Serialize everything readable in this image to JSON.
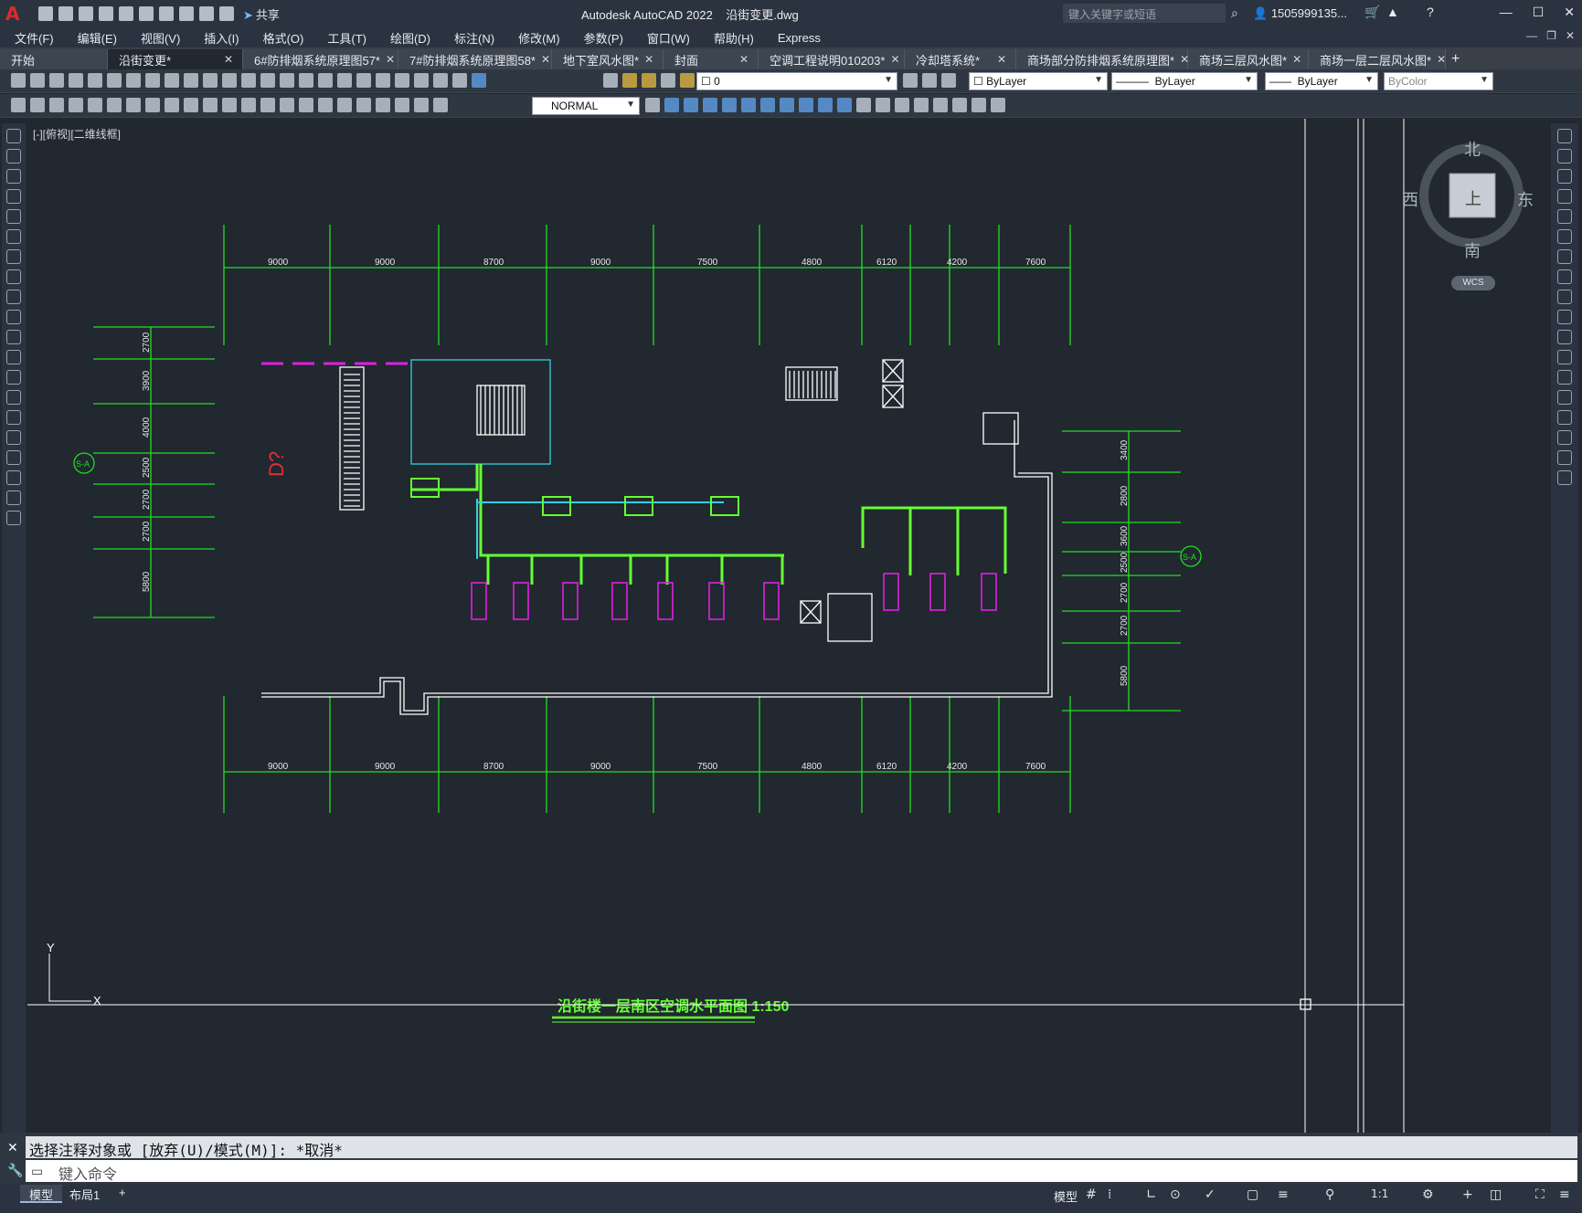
{
  "window": {
    "title": "Autodesk AutoCAD 2022",
    "filename": "沿街变更.dwg",
    "share": "共享",
    "search_placeholder": "键入关键字或短语",
    "user": "1505999135...",
    "logo": "A"
  },
  "menu": [
    "文件(F)",
    "编辑(E)",
    "视图(V)",
    "插入(I)",
    "格式(O)",
    "工具(T)",
    "绘图(D)",
    "标注(N)",
    "修改(M)",
    "参数(P)",
    "窗口(W)",
    "帮助(H)",
    "Express"
  ],
  "tabs": [
    {
      "label": "开始",
      "active": false,
      "closable": false
    },
    {
      "label": "沿街变更*",
      "active": true,
      "closable": true
    },
    {
      "label": "6#防排烟系统原理图57*",
      "active": false,
      "closable": true
    },
    {
      "label": "7#防排烟系统原理图58*",
      "active": false,
      "closable": true
    },
    {
      "label": "地下室风水图*",
      "active": false,
      "closable": true
    },
    {
      "label": "封面",
      "active": false,
      "closable": true
    },
    {
      "label": "空调工程说明010203*",
      "active": false,
      "closable": true
    },
    {
      "label": "冷却塔系统*",
      "active": false,
      "closable": true
    },
    {
      "label": "商场部分防排烟系统原理图*",
      "active": false,
      "closable": true
    },
    {
      "label": "商场三层风水图*",
      "active": false,
      "closable": true
    },
    {
      "label": "商场一层二层风水图*",
      "active": false,
      "closable": true
    }
  ],
  "toolbar": {
    "layer_value": "0",
    "color_value": "ByLayer",
    "linetype_value": "ByLayer",
    "lineweight_value": "ByLayer",
    "plotstyle_value": "ByColor",
    "textstyle_value": "NORMAL"
  },
  "viewport": {
    "label": "[-][俯视][二维线框]"
  },
  "viewcube": {
    "north": "北",
    "south": "南",
    "east": "东",
    "west": "西",
    "face": "上",
    "wcs": "WCS"
  },
  "drawing": {
    "top_dims": [
      "9000",
      "9000",
      "8700",
      "9000",
      "7500",
      "4800",
      "6120",
      "4200",
      "7600"
    ],
    "bottom_dims": [
      "9000",
      "9000",
      "8700",
      "9000",
      "7500",
      "4800",
      "6120",
      "4200",
      "7600"
    ],
    "left_dims": [
      "2700",
      "3900",
      "4000",
      "2500",
      "2700",
      "2700",
      "5800"
    ],
    "right_dims": [
      "3400",
      "2800",
      "3600",
      "2500",
      "2700",
      "2700",
      "5800"
    ],
    "left_axis": "S-A",
    "right_axis": "S-A",
    "red_text": "D?",
    "title": "沿街楼一层南区空调水平面图 1:150",
    "ucs_y": "Y",
    "ucs_x": "X"
  },
  "command": {
    "history": "选择注释对象或 [放弃(U)/模式(M)]: *取消*",
    "placeholder": "键入命令"
  },
  "status": {
    "model_tab": "模型",
    "layout_tab": "布局1",
    "add": "+",
    "model_label": "模型",
    "scale": "1:1"
  },
  "colors": {
    "background": "#212830",
    "grid_green": "#22dd22",
    "pipe_green": "#66ff33",
    "cyan": "#33d0e0",
    "magenta": "#e020e0"
  }
}
